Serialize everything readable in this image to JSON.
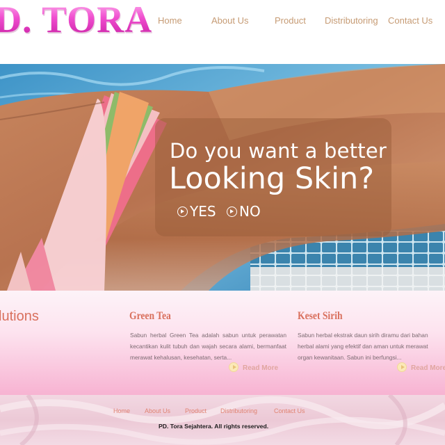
{
  "header": {
    "logo_text": "D. TORA",
    "nav": [
      "Home",
      "About Us",
      "Product",
      "Distributoring",
      "Contact Us"
    ]
  },
  "hero": {
    "line1": "Do you want a better",
    "line2": "Looking Skin?",
    "yes_label": "YES",
    "no_label": "NO"
  },
  "content": {
    "col1_title": "lutions",
    "col2_title": "Green Tea",
    "col2_text": "Sabun herbal Green Tea adalah sabun untuk perawatan kecantikan kulit tubuh dan wajah secara alami, bermanfaat merawat kehalusan, kesehatan, serta...",
    "col2_readmore": "Read More",
    "col3_title": "Keset Sirih",
    "col3_lines": [
      "Sabun herbal ekstrak daun sirih diramu dari bahan",
      "herbal alami yang efektif dan aman untuk merawat",
      "organ kewanitaan. Sabun ini berfungsi..."
    ],
    "col3_readmore": "Read More"
  },
  "footer": {
    "nav": [
      "Home",
      "About Us",
      "Product",
      "Distributoring",
      "Contact Us"
    ],
    "copyright": "PD. Tora Sejahtera. All rights reserved."
  },
  "colors": {
    "logo_pink": "#e85bd0",
    "nav_tan": "#c69b74",
    "title_coral": "#d9705d",
    "band_pink": "#f7b3d2"
  }
}
